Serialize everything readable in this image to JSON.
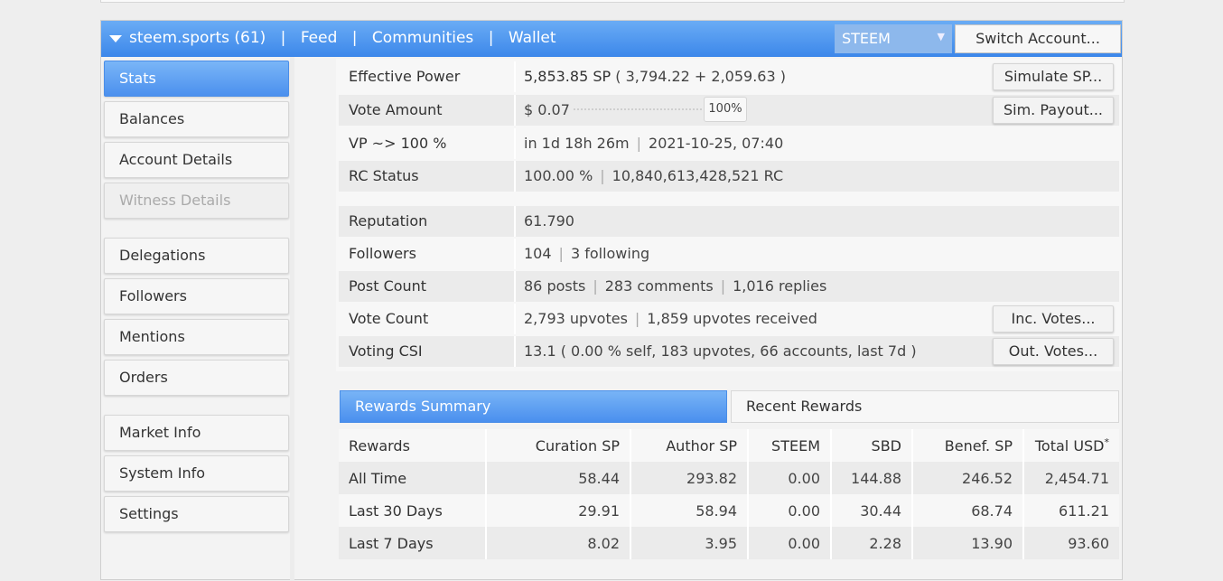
{
  "header": {
    "account": "steem.sports (61)",
    "links": [
      "Feed",
      "Communities",
      "Wallet"
    ],
    "separator": "|",
    "currency_select": "STEEM",
    "switch_button": "Switch Account..."
  },
  "sidebar": {
    "items": [
      {
        "label": "Stats",
        "state": "active"
      },
      {
        "label": "Balances",
        "state": "normal"
      },
      {
        "label": "Account Details",
        "state": "normal"
      },
      {
        "label": "Witness Details",
        "state": "disabled"
      },
      {
        "label": "Delegations",
        "state": "normal"
      },
      {
        "label": "Followers",
        "state": "normal"
      },
      {
        "label": "Mentions",
        "state": "normal"
      },
      {
        "label": "Orders",
        "state": "normal"
      },
      {
        "label": "Market Info",
        "state": "normal"
      },
      {
        "label": "System Info",
        "state": "normal"
      },
      {
        "label": "Settings",
        "state": "normal"
      }
    ]
  },
  "stats": {
    "effective_power": {
      "label": "Effective Power",
      "value_bold": "5,853.85 SP",
      "value_rest": "( 3,794.22 + 2,059.63 )",
      "button": "Simulate SP..."
    },
    "vote_amount": {
      "label": "Vote Amount",
      "value": "$ 0.07",
      "slider_percent": "100%",
      "button": "Sim. Payout..."
    },
    "vp": {
      "label": "VP ~> 100 %",
      "value_a": "in 1d 18h 26m",
      "value_b": "2021-10-25, 07:40"
    },
    "rc_status": {
      "label": "RC Status",
      "value_a": "100.00 %",
      "value_b": "10,840,613,428,521 RC"
    },
    "reputation": {
      "label": "Reputation",
      "value": "61.790"
    },
    "followers": {
      "label": "Followers",
      "value_a": "104",
      "value_b": "3 following"
    },
    "post_count": {
      "label": "Post Count",
      "value_a": "86 posts",
      "value_b": "283 comments",
      "value_c": "1,016 replies"
    },
    "vote_count": {
      "label": "Vote Count",
      "value_a": "2,793 upvotes",
      "value_b": "1,859 upvotes received",
      "button": "Inc. Votes..."
    },
    "voting_csi": {
      "label": "Voting CSI",
      "value": "13.1 ( 0.00 % self, 183 upvotes, 66 accounts, last 7d )",
      "button": "Out. Votes..."
    },
    "pipe": "|"
  },
  "rewards": {
    "tabs": [
      "Rewards Summary",
      "Recent Rewards"
    ],
    "columns": [
      "Rewards",
      "Curation SP",
      "Author SP",
      "STEEM",
      "SBD",
      "Benef. SP",
      "Total USD"
    ],
    "total_marker": "*",
    "rows": [
      [
        "All Time",
        "58.44",
        "293.82",
        "0.00",
        "144.88",
        "246.52",
        "2,454.71"
      ],
      [
        "Last 30 Days",
        "29.91",
        "58.94",
        "0.00",
        "30.44",
        "68.74",
        "611.21"
      ],
      [
        "Last 7 Days",
        "8.02",
        "3.95",
        "0.00",
        "2.28",
        "13.90",
        "93.60"
      ]
    ]
  }
}
